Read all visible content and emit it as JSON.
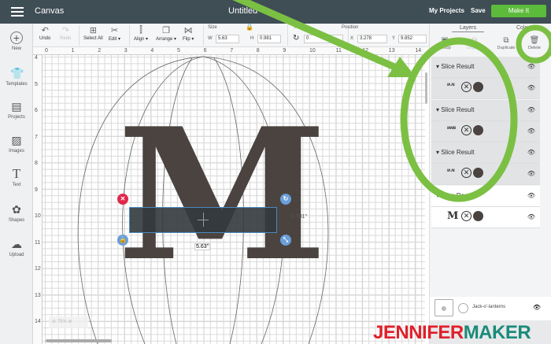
{
  "header": {
    "app": "Canvas",
    "title": "Untitled",
    "my_projects": "My Projects",
    "save": "Save",
    "make_it": "Make It"
  },
  "sidebar": [
    {
      "label": "New",
      "icon": "plus-circle-icon"
    },
    {
      "label": "Templates",
      "icon": "tshirt-icon"
    },
    {
      "label": "Projects",
      "icon": "notebook-icon"
    },
    {
      "label": "Images",
      "icon": "image-icon"
    },
    {
      "label": "Text",
      "icon": "text-icon"
    },
    {
      "label": "Shapes",
      "icon": "shapes-icon"
    },
    {
      "label": "Upload",
      "icon": "upload-icon"
    }
  ],
  "toolbar": {
    "undo": "Undo",
    "redo": "Redo",
    "select_all": "Select All",
    "edit": "Edit ▾",
    "align": "Align ▾",
    "arrange": "Arrange ▾",
    "flip": "Flip ▾",
    "size_label": "Size",
    "w_label": "W",
    "w": "5.63",
    "h_label": "H",
    "h": "0.981",
    "rotate_label": "Rota",
    "rotate": "0",
    "position_label": "Position",
    "x_label": "X",
    "x": "3.278",
    "y_label": "Y",
    "y": "9.852"
  },
  "ruler_top": [
    "0",
    "1",
    "2",
    "3",
    "4",
    "5",
    "6",
    "7",
    "8",
    "9",
    "10",
    "11",
    "12",
    "13",
    "14"
  ],
  "ruler_left": [
    "4",
    "5",
    "6",
    "7",
    "8",
    "9",
    "10",
    "11",
    "12",
    "13",
    "14"
  ],
  "canvas": {
    "width_readout": "5.63\"",
    "height_readout": "0.981\"",
    "zoom": "75%",
    "letter": "M"
  },
  "panel": {
    "tabs": [
      "Layers",
      "Color Sync"
    ],
    "actions": [
      "Group",
      "Ungroup",
      "Duplicate",
      "Delete"
    ],
    "layers": [
      {
        "name": "Slice Result",
        "thumb": "ıʌ ʌı"
      },
      {
        "name": "Slice Result",
        "thumb": "ıʌʍıı"
      },
      {
        "name": "Slice Result",
        "thumb": "ıʌ ʌı"
      },
      {
        "name": "Slice Result",
        "thumb": "M"
      }
    ],
    "blank_canvas": "Jack-o'-lanterns"
  },
  "watermark": {
    "left": "JENNIFER",
    "right": "MAKER"
  },
  "colors": {
    "header": "#3f4d55",
    "make_it": "#5cbb3a",
    "annotation": "#7bc043",
    "letter": "#4a4340",
    "watermark_red": "#e0202b",
    "watermark_teal": "#1a8b7a"
  }
}
